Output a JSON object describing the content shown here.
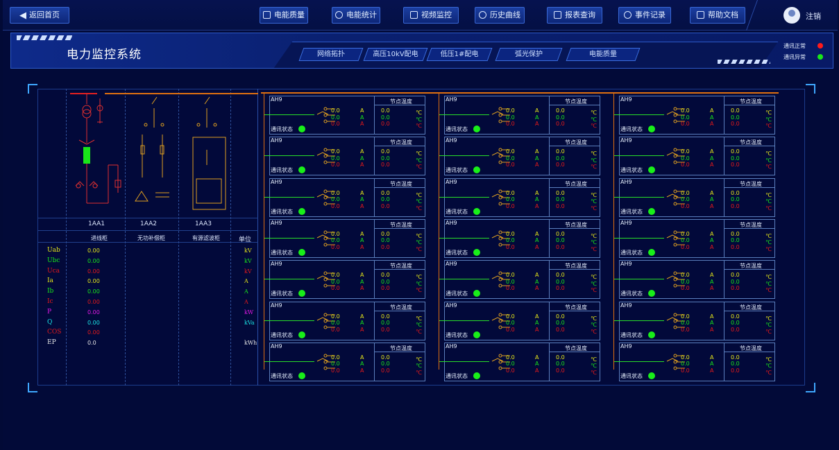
{
  "nav": {
    "back": "返回首页",
    "items": [
      {
        "label": "电能质量",
        "icon": "shield-icon"
      },
      {
        "label": "电能统计",
        "icon": "pie-icon"
      },
      {
        "label": "视频监控",
        "icon": "video-icon"
      },
      {
        "label": "历史曲线",
        "icon": "chart-icon"
      },
      {
        "label": "报表查询",
        "icon": "search-icon"
      },
      {
        "label": "事件记录",
        "icon": "document-icon"
      },
      {
        "label": "帮助文档",
        "icon": "help-icon"
      }
    ],
    "user": "注销"
  },
  "header": {
    "title": "电力监控系统",
    "tabs": [
      "网络拓扑",
      "高压10kV配电",
      "低压1#配电",
      "弧光保护",
      "电能质量"
    ],
    "legend": [
      {
        "label": "通讯正常",
        "color": "#ff1a1a"
      },
      {
        "label": "通讯异常",
        "color": "#19e619"
      }
    ]
  },
  "cabinets": {
    "ids": [
      "1AA1",
      "1AA2",
      "1AA3"
    ],
    "names": [
      "进线柜",
      "无功补偿柜",
      "有源滤波柜"
    ],
    "unit_header": "单位"
  },
  "measures": [
    {
      "name": "Uab",
      "value": "0.00",
      "unit": "kV",
      "color": "#e6e61a"
    },
    {
      "name": "Ubc",
      "value": "0.00",
      "unit": "kV",
      "color": "#1ae61a"
    },
    {
      "name": "Uca",
      "value": "0.00",
      "unit": "kV",
      "color": "#e61a1a"
    },
    {
      "name": "Ia",
      "value": "0.00",
      "unit": "A",
      "color": "#e6e61a"
    },
    {
      "name": "Ib",
      "value": "0.00",
      "unit": "A",
      "color": "#1ae61a"
    },
    {
      "name": "Ic",
      "value": "0.00",
      "unit": "A",
      "color": "#e61a1a"
    },
    {
      "name": "P",
      "value": "0.00",
      "unit": "kW",
      "color": "#e61ae6"
    },
    {
      "name": "Q",
      "value": "0.00",
      "unit": "kVa",
      "color": "#1ae6e6"
    },
    {
      "name": "COS",
      "value": "0.00",
      "unit": "",
      "color": "#e61a1a"
    },
    {
      "name": "EP",
      "value": "0.0",
      "unit": "kWh",
      "color": "#e6e6e6"
    }
  ],
  "feeder": {
    "title": "AH9",
    "temp_label": "节点温度",
    "comm_label": "通讯状态",
    "values": [
      "0.0",
      "0.0",
      "0.0"
    ],
    "current_unit": "A",
    "temps": [
      "0.0",
      "0.0",
      "0.0"
    ],
    "temp_unit": "℃",
    "colors": [
      "#e6e61a",
      "#1ae61a",
      "#e61a1a"
    ]
  }
}
